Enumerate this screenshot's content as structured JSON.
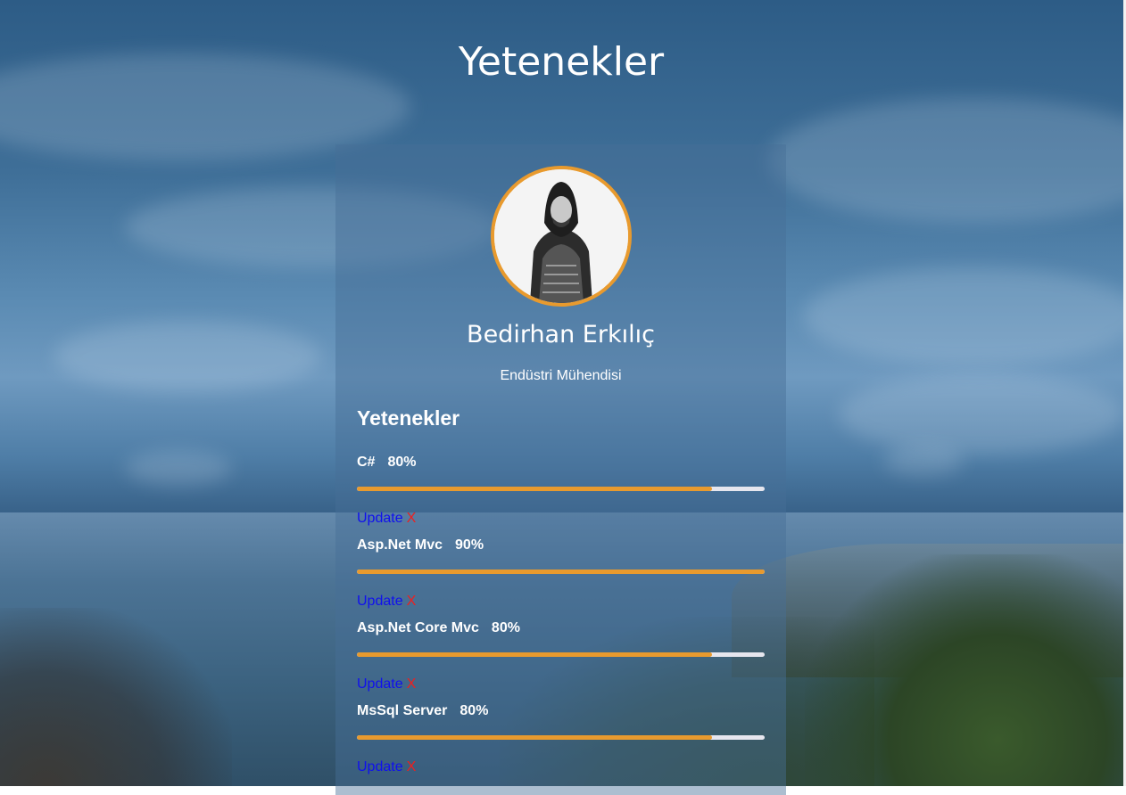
{
  "page": {
    "title": "Yetenekler"
  },
  "profile": {
    "name": "Bedirhan Erkılıç",
    "role": "Endüstri Mühendisi"
  },
  "skills_section": {
    "heading": "Yetenekler",
    "items": [
      {
        "name": "C#",
        "percent_label": "80%",
        "level": 0.87,
        "update_label": "Update",
        "delete_label": "X"
      },
      {
        "name": "Asp.Net Mvc",
        "percent_label": "90%",
        "level": 1.0,
        "update_label": "Update",
        "delete_label": "X"
      },
      {
        "name": "Asp.Net Core Mvc",
        "percent_label": "80%",
        "level": 0.87,
        "update_label": "Update",
        "delete_label": "X"
      },
      {
        "name": "MsSql Server",
        "percent_label": "80%",
        "level": 0.87,
        "update_label": "Update",
        "delete_label": "X"
      }
    ]
  },
  "colors": {
    "accent": "#e89a2e",
    "bar_track": "#e6e6ee",
    "update_link": "#1010ee",
    "delete_link": "#ee1f1f"
  }
}
